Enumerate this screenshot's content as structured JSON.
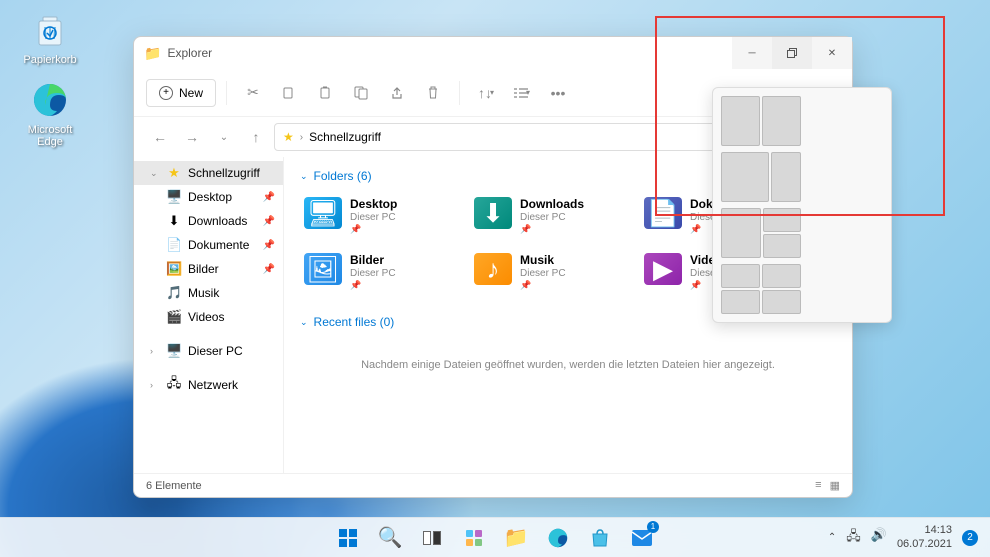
{
  "desktop_icons": {
    "recycle": "Papierkorb",
    "edge": "Microsoft Edge"
  },
  "window": {
    "title": "Explorer",
    "new_btn": "New",
    "breadcrumb": "Schnellzugriff"
  },
  "sidebar": {
    "quickaccess": "Schnellzugriff",
    "items": [
      {
        "label": "Desktop",
        "icon": "🖥️",
        "pinned": true
      },
      {
        "label": "Downloads",
        "icon": "⬇",
        "pinned": true
      },
      {
        "label": "Dokumente",
        "icon": "📄",
        "pinned": true
      },
      {
        "label": "Bilder",
        "icon": "🖼️",
        "pinned": true
      },
      {
        "label": "Musik",
        "icon": "🎵",
        "pinned": false
      },
      {
        "label": "Videos",
        "icon": "🎬",
        "pinned": false
      }
    ],
    "this_pc": "Dieser PC",
    "network": "Netzwerk"
  },
  "sections": {
    "folders_header": "Folders (6)",
    "recent_header": "Recent files (0)",
    "empty_msg": "Nachdem einige Dateien geöffnet wurden, werden die letzten Dateien hier angezeigt."
  },
  "folders": [
    {
      "name": "Desktop",
      "sub": "Dieser PC",
      "color": "fi-cyan",
      "glyph": "🖥"
    },
    {
      "name": "Downloads",
      "sub": "Dieser PC",
      "color": "fi-teal",
      "glyph": "⬇"
    },
    {
      "name": "Dokumente",
      "sub": "Dieser PC",
      "color": "fi-blue",
      "glyph": "📄"
    },
    {
      "name": "Bilder",
      "sub": "Dieser PC",
      "color": "fi-indigo",
      "glyph": "🖼"
    },
    {
      "name": "Musik",
      "sub": "Dieser PC",
      "color": "fi-orange",
      "glyph": "♪"
    },
    {
      "name": "Videos",
      "sub": "Dieser PC",
      "color": "fi-purple",
      "glyph": "▶"
    }
  ],
  "status": {
    "count": "6 Elemente"
  },
  "taskbar": {
    "badge1": "1",
    "notif_count": "2",
    "time": "14:13",
    "date": "06.07.2021"
  }
}
